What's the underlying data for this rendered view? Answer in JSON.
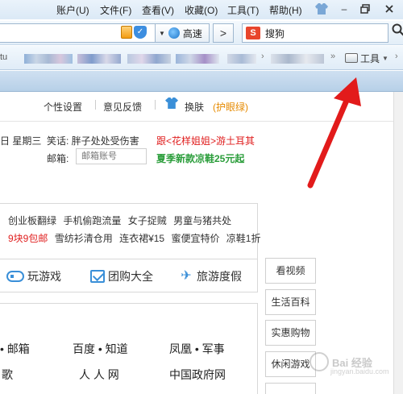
{
  "menubar": {
    "items": [
      "账户(U)",
      "文件(F)",
      "查看(V)",
      "收藏(O)",
      "工具(T)",
      "帮助(H)"
    ]
  },
  "addressbar": {
    "speed_label": "高速",
    "go_label": ">",
    "search_engine_letter": "S",
    "search_text": "搜狗"
  },
  "favbar": {
    "left_text": "tu",
    "more_chevron": "»",
    "tools_label": "工具"
  },
  "page": {
    "settings_link": "个性设置",
    "feedback_link": "意见反馈",
    "skin_link": "换肤",
    "eye_care_link": "(护眼绿)",
    "date_text": "日 星期三",
    "joke_text": "笑话: 胖子处处受伤害",
    "mail_label": "邮箱:",
    "mail_placeholder": "邮箱账号",
    "promo_red": "跟<花样姐姐>游土耳其",
    "promo_green": "夏季新款凉鞋25元起",
    "hot_row1": [
      "创业板翻绿",
      "手机偷跑流量",
      "女子捉贼",
      "男童与猪共处"
    ],
    "hot_row2": [
      {
        "text": "9块9包邮",
        "red": true
      },
      {
        "text": "雪纺衫清仓用",
        "red": false
      },
      {
        "text": "连衣裙¥15",
        "red": false
      },
      {
        "text": "蜜便宜特价",
        "red": false
      },
      {
        "text": "凉鞋1折",
        "red": false
      }
    ],
    "services": [
      "玩游戏",
      "团购大全",
      "旅游度假"
    ],
    "categories": [
      "看视频",
      "生活百科",
      "实惠购物",
      "休闲游戏"
    ],
    "links": [
      "• 邮箱",
      "百度 • 知道",
      "凤凰 • 军事",
      "歌",
      "人 人 网",
      "中国政府网"
    ]
  },
  "watermark": {
    "text": "Bai 经验",
    "sub": "jingyan.baidu.com"
  },
  "colors": {
    "accent_blue": "#3a8fd8",
    "promo_red": "#e02020",
    "promo_green": "#2a9d3a",
    "eye_care_orange": "#e68a00",
    "arrow_red": "#e21b1b"
  }
}
